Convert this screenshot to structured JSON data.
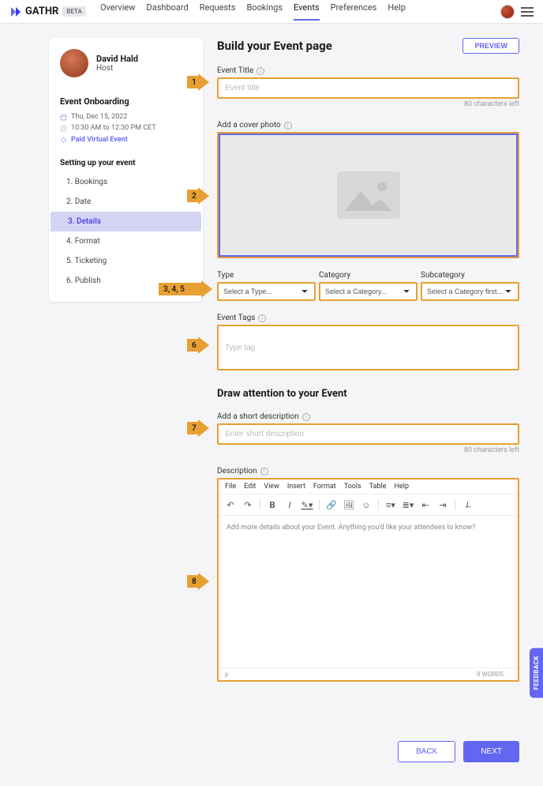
{
  "brand": "GATHR",
  "beta": "BETA",
  "nav": {
    "items": [
      "Overview",
      "Dashboard",
      "Requests",
      "Bookings",
      "Events",
      "Preferences",
      "Help"
    ],
    "active": 4
  },
  "user": {
    "name": "David Hald",
    "role": "Host"
  },
  "sidebar": {
    "onboarding_title": "Event Onboarding",
    "date": "Thu, Dec 15, 2022",
    "time": "10:30 AM to 12:30 PM CET",
    "paid": "Paid Virtual Event",
    "steps_title": "Setting up your event",
    "steps": [
      "1. Bookings",
      "2. Date",
      "3. Details",
      "4. Format",
      "5. Ticketing",
      "6. Publish"
    ],
    "active_step": 2
  },
  "page": {
    "title": "Build your Event page",
    "preview": "PREVIEW",
    "event_title_label": "Event Title",
    "event_title_ph": "Event title",
    "char_limit": "80 characters left",
    "cover_label": "Add a cover photo",
    "type_label": "Type",
    "category_label": "Category",
    "subcategory_label": "Subcategory",
    "type_ph": "Select a Type...",
    "category_ph": "Select a Category...",
    "subcategory_ph": "Select a Category first...",
    "tags_label": "Event Tags",
    "tags_ph": "Type tag",
    "attention_heading": "Draw attention to your Event",
    "short_desc_label": "Add a short description",
    "short_desc_ph": "Enter short description",
    "desc_label": "Description",
    "editor_menu": [
      "File",
      "Edit",
      "View",
      "Insert",
      "Format",
      "Tools",
      "Table",
      "Help"
    ],
    "editor_ph": "Add more details about your Event. Anything you'd like your attendees to know?",
    "editor_path": "p",
    "editor_words": "0 WORDS",
    "back": "BACK",
    "next": "NEXT"
  },
  "arrows": {
    "a1": "1",
    "a2": "2",
    "a345": "3, 4, 5",
    "a6": "6",
    "a7": "7",
    "a8": "8"
  },
  "feedback": "FEEDBACK"
}
